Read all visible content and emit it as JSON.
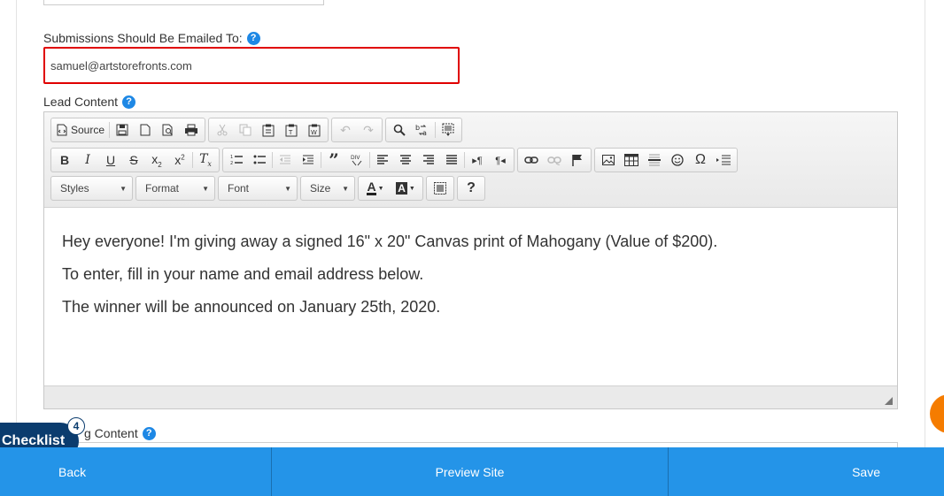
{
  "email_field": {
    "label": "Submissions Should Be Emailed To:",
    "value": "samuel@artstorefronts.com"
  },
  "lead_content": {
    "label": "Lead Content",
    "toolbar": {
      "source_label": "Source",
      "styles_label": "Styles",
      "format_label": "Format",
      "font_label": "Font",
      "size_label": "Size"
    },
    "paragraphs": [
      "Hey everyone! I'm giving away a signed 16\" x 20\" Canvas print of Mahogany  (Value of $200).",
      "To enter, fill in your name and email address below.",
      "The winner will be announced on January 25th, 2020."
    ]
  },
  "partial_label": "g Content",
  "checklist": {
    "label": "Checklist",
    "count": "4"
  },
  "bottom_bar": {
    "back_label": "Back",
    "preview_label": "Preview Site",
    "save_label": "Save"
  },
  "colors": {
    "accent": "#2494e8",
    "highlight_border": "#e00000",
    "checklist_bg": "#0b3c6e",
    "orange": "#f57c00"
  }
}
